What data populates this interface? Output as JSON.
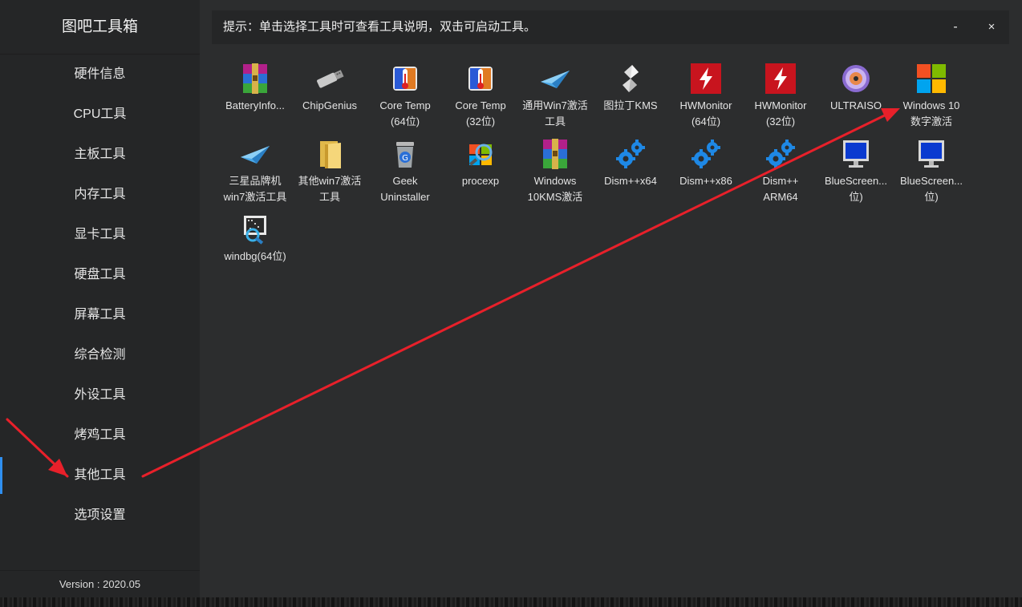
{
  "app": {
    "title": "图吧工具箱",
    "version": "Version : 2020.05"
  },
  "header": {
    "tip": "提示：单击选择工具时可查看工具说明，双击可启动工具。",
    "minimize": "-",
    "close": "×"
  },
  "sidebar": {
    "items": [
      {
        "label": "硬件信息"
      },
      {
        "label": "CPU工具"
      },
      {
        "label": "主板工具"
      },
      {
        "label": "内存工具"
      },
      {
        "label": "显卡工具"
      },
      {
        "label": "硬盘工具"
      },
      {
        "label": "屏幕工具"
      },
      {
        "label": "综合检测"
      },
      {
        "label": "外设工具"
      },
      {
        "label": "烤鸡工具"
      },
      {
        "label": "其他工具"
      },
      {
        "label": "选项设置"
      }
    ],
    "active": "其他工具"
  },
  "tools": [
    {
      "l1": "BatteryInfo...",
      "l2": "",
      "icon": "winrar-archive-icon"
    },
    {
      "l1": "ChipGenius",
      "l2": "",
      "icon": "usb-drive-icon"
    },
    {
      "l1": "Core Temp",
      "l2": "(64位)",
      "icon": "thermometer-icon"
    },
    {
      "l1": "Core Temp",
      "l2": "(32位)",
      "icon": "thermometer-icon"
    },
    {
      "l1": "通用Win7激活",
      "l2": "工具",
      "icon": "paper-plane-icon"
    },
    {
      "l1": "图拉丁KMS",
      "l2": "",
      "icon": "script-scroll-icon"
    },
    {
      "l1": "HWMonitor",
      "l2": "(64位)",
      "icon": "hwmonitor-bolt-icon"
    },
    {
      "l1": "HWMonitor",
      "l2": "(32位)",
      "icon": "hwmonitor-bolt-icon"
    },
    {
      "l1": "ULTRAISO",
      "l2": "",
      "icon": "optical-disc-icon"
    },
    {
      "l1": "Windows 10",
      "l2": "数字激活",
      "icon": "windows-logo-icon"
    },
    {
      "l1": "三星品牌机",
      "l2": "win7激活工具",
      "icon": "paper-plane-icon"
    },
    {
      "l1": "其他win7激活",
      "l2": "工具",
      "icon": "folder-icon"
    },
    {
      "l1": "Geek",
      "l2": "Uninstaller",
      "icon": "trash-can-icon"
    },
    {
      "l1": "procexp",
      "l2": "",
      "icon": "process-explorer-icon"
    },
    {
      "l1": "Windows",
      "l2": "10KMS激活",
      "icon": "winrar-archive-icon"
    },
    {
      "l1": "Dism++x64",
      "l2": "",
      "icon": "gears-icon"
    },
    {
      "l1": "Dism++x86",
      "l2": "",
      "icon": "gears-icon"
    },
    {
      "l1": "Dism++",
      "l2": "ARM64",
      "icon": "gears-icon"
    },
    {
      "l1": "BlueScreen...",
      "l2": "位)",
      "icon": "monitor-icon"
    },
    {
      "l1": "BlueScreen...",
      "l2": "位)",
      "icon": "monitor-icon"
    },
    {
      "l1": "windbg(64位)",
      "l2": "",
      "icon": "debugger-icon"
    }
  ],
  "colors": {
    "window_bg": "#2c2d2e",
    "sidebar_bg": "#252627",
    "header_bg": "#252627",
    "accent": "#2f8ff0",
    "annotation_arrow": "#e8202a"
  }
}
